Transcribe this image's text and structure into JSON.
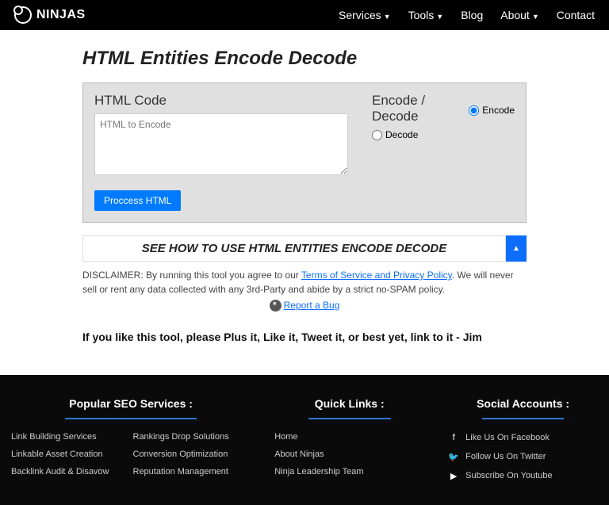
{
  "nav": {
    "brand": "NINJAS",
    "items": [
      {
        "label": "Services",
        "drop": true
      },
      {
        "label": "Tools",
        "drop": true
      },
      {
        "label": "Blog",
        "drop": false
      },
      {
        "label": "About",
        "drop": true
      },
      {
        "label": "Contact",
        "drop": false
      }
    ]
  },
  "page": {
    "title": "HTML Entities Encode Decode"
  },
  "tool": {
    "code_label": "HTML Code",
    "placeholder": "HTML to Encode",
    "mode_label": "Encode / Decode",
    "encode": "Encode",
    "decode": "Decode",
    "process": "Proccess HTML"
  },
  "see": {
    "text": "SEE HOW TO USE HTML ENTITIES ENCODE DECODE"
  },
  "disclaimer": {
    "pre": "DISCLAIMER: By running this tool you agree to our ",
    "link": "Terms of Service and Privacy Policy",
    "post": ". We will never sell or rent any data collected with any 3rd-Party and abide by a strict no-SPAM policy."
  },
  "bug": {
    "label": "Report a Bug"
  },
  "share": "If you like this tool, please Plus it, Like it, Tweet it, or best yet, link to it - Jim",
  "footer": {
    "col1": {
      "title": "Popular SEO Services :",
      "a": [
        "Link Building Services",
        "Linkable Asset Creation",
        "Backlink Audit & Disavow"
      ],
      "b": [
        "Rankings Drop Solutions",
        "Conversion Optimization",
        "Reputation Management"
      ]
    },
    "col2": {
      "title": "Quick Links :",
      "items": [
        "Home",
        "About Ninjas",
        "Ninja Leadership Team"
      ]
    },
    "col3": {
      "title": "Social Accounts :",
      "items": [
        "Like Us On Facebook",
        "Follow Us On Twitter",
        "Subscribe On Youtube"
      ]
    }
  }
}
